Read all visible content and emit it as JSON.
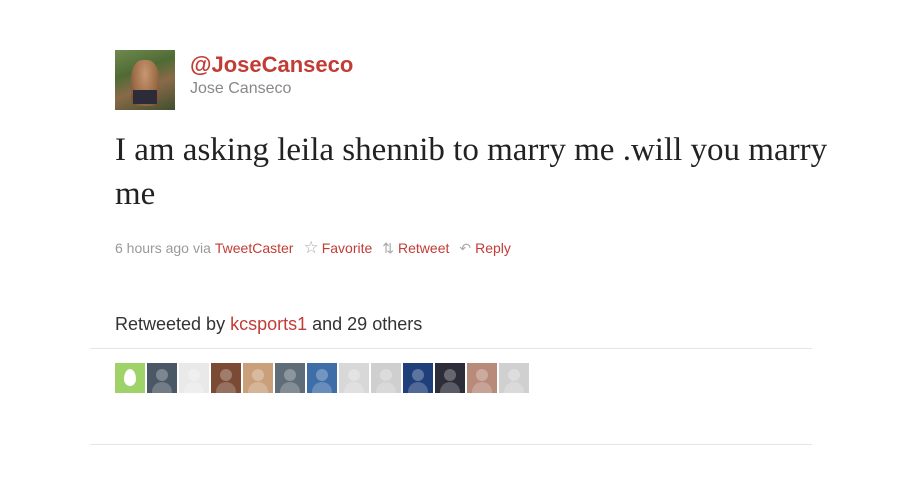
{
  "tweet": {
    "handle": "@JoseCanseco",
    "display_name": "Jose Canseco",
    "text": "I am asking leila shennib to marry me .will you marry me",
    "time": "6 hours ago",
    "via_prefix": "via",
    "via_app": "TweetCaster",
    "actions": {
      "favorite": "Favorite",
      "retweet": "Retweet",
      "reply": "Reply"
    }
  },
  "retweets": {
    "prefix": "Retweeted by",
    "user": "kcsports1",
    "suffix": "and 29 others",
    "avatars": [
      {
        "icon": "default-egg-avatar",
        "color": "#9fd36a"
      },
      {
        "icon": "user-avatar",
        "color": "#4a5866"
      },
      {
        "icon": "crest-avatar",
        "color": "#e9e9e9"
      },
      {
        "icon": "user-avatar",
        "color": "#7a4a34"
      },
      {
        "icon": "user-avatar",
        "color": "#c9a07a"
      },
      {
        "icon": "user-avatar",
        "color": "#5f6d78"
      },
      {
        "icon": "user-avatar",
        "color": "#3e6ea8"
      },
      {
        "icon": "user-avatar",
        "color": "#d8d8d8"
      },
      {
        "icon": "user-avatar",
        "color": "#cfcfcf"
      },
      {
        "icon": "user-avatar",
        "color": "#1f3f7a"
      },
      {
        "icon": "user-avatar",
        "color": "#2d2d3a"
      },
      {
        "icon": "user-avatar",
        "color": "#b88a7a"
      },
      {
        "icon": "user-avatar",
        "color": "#d0d0d0"
      }
    ]
  },
  "colors": {
    "link": "#c23c36",
    "muted": "#999999"
  }
}
